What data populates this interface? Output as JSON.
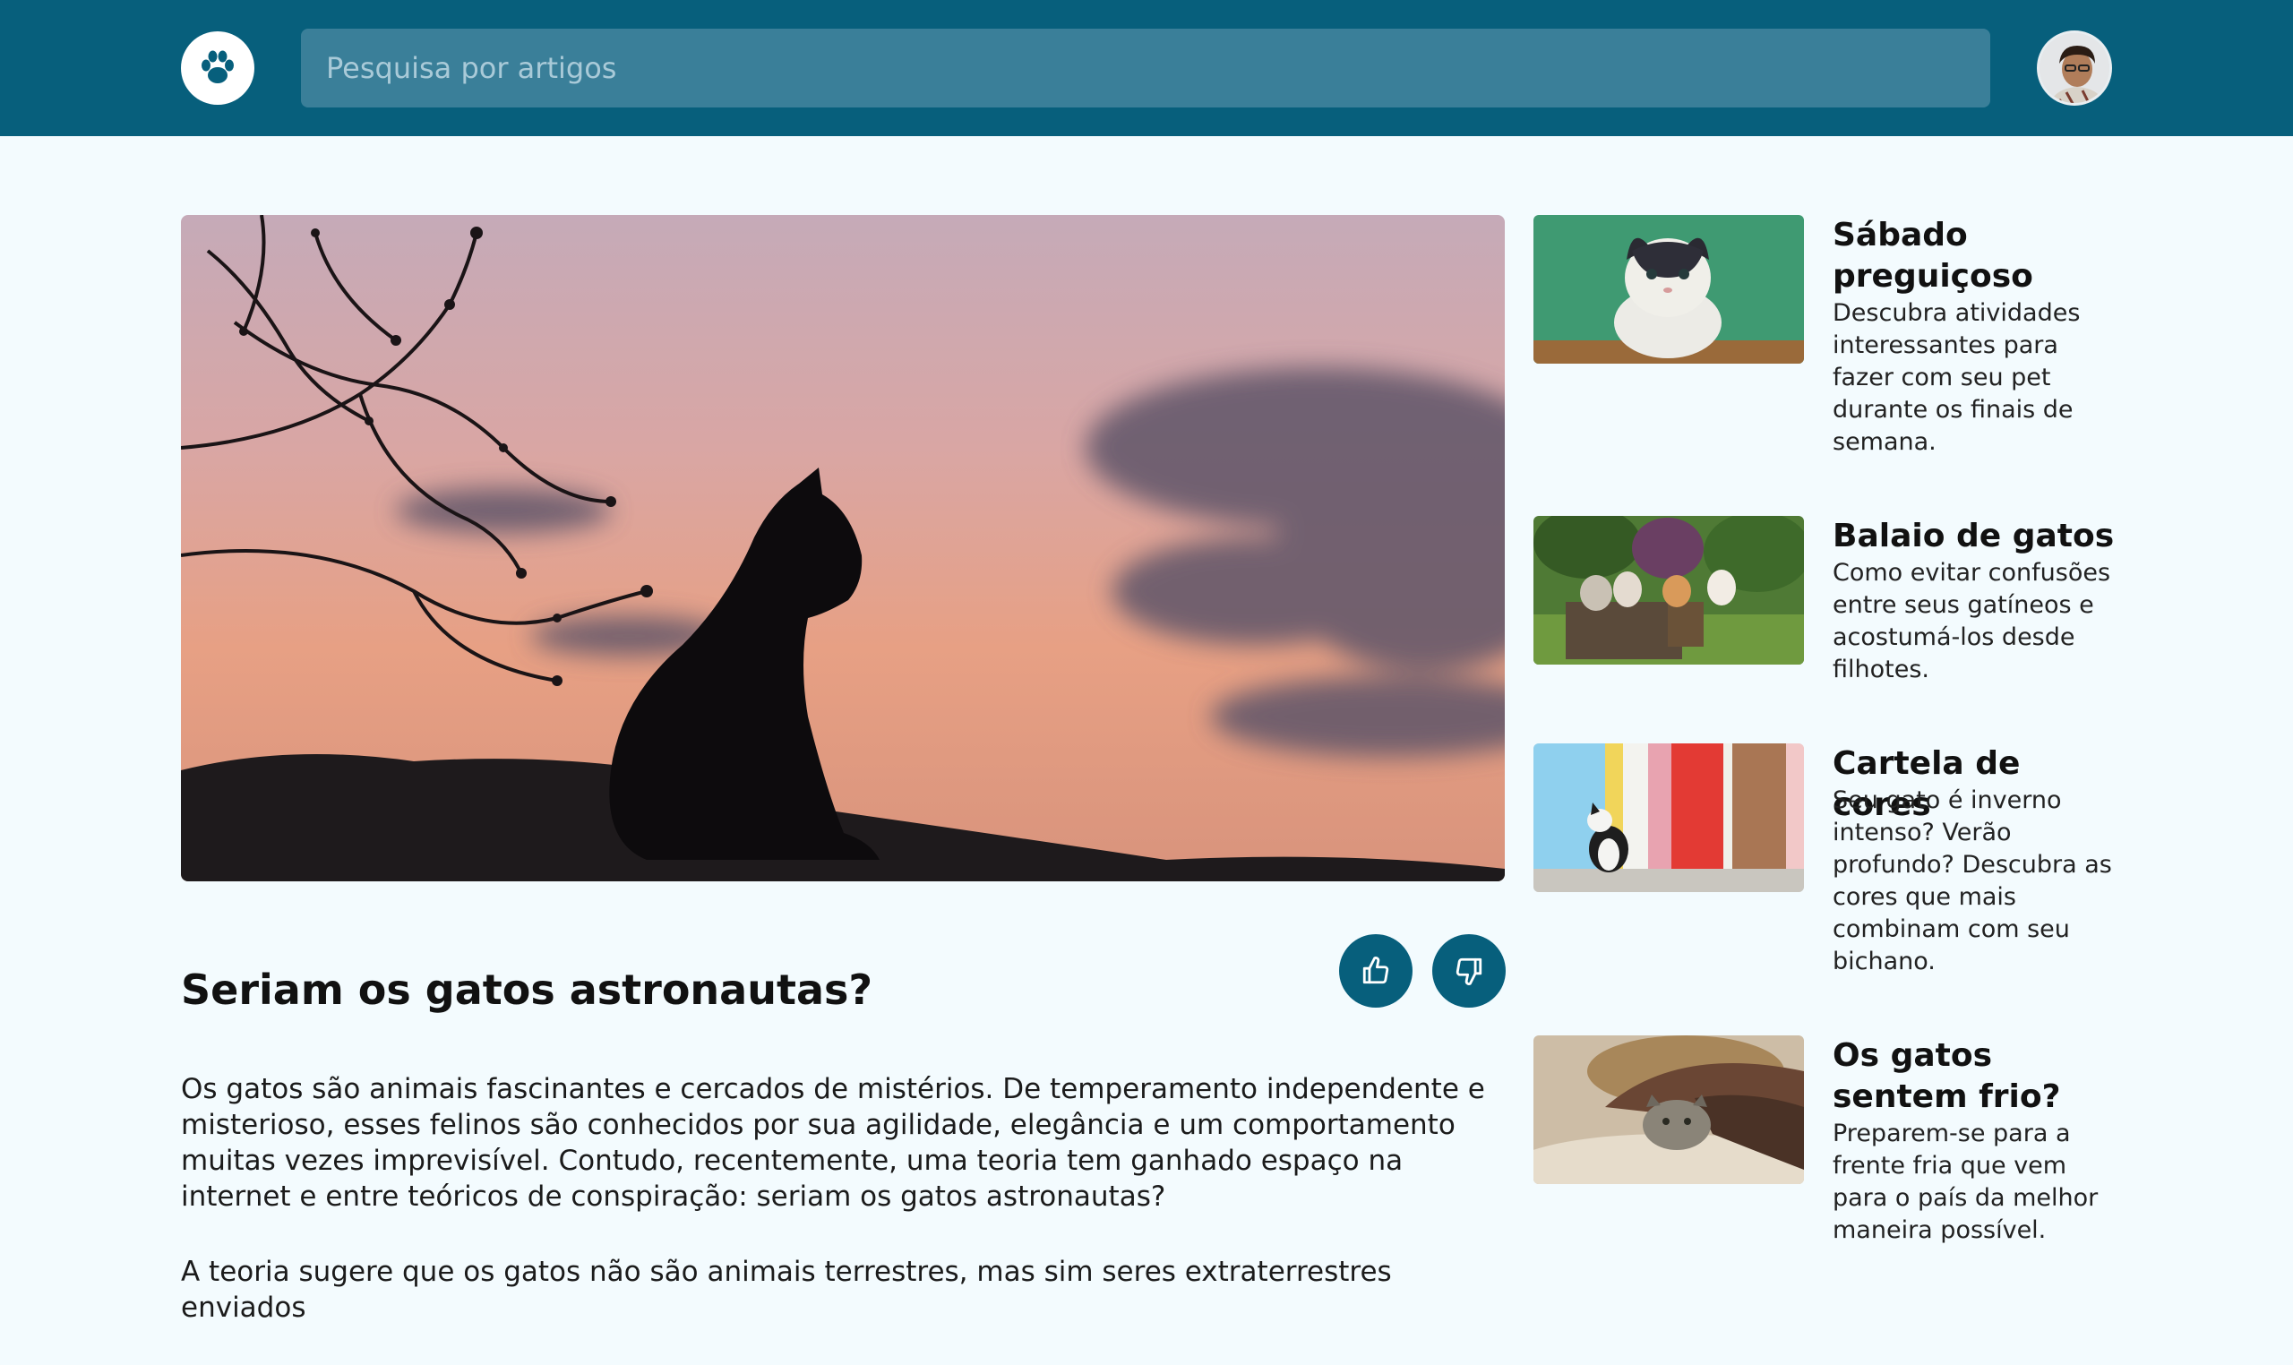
{
  "header": {
    "search_placeholder": "Pesquisa por artigos"
  },
  "article": {
    "title": "Seriam os gatos astronautas?",
    "paragraphs": [
      "Os gatos são animais fascinantes e cercados de mistérios. De temperamento independente e misterioso, esses felinos são conhecidos por sua agilidade, elegância e um comportamento muitas vezes imprevisível. Contudo, recentemente, uma teoria tem ganhado espaço na internet e entre teóricos de conspiração: seriam os gatos astronautas?",
      "A teoria sugere que os gatos não são animais terrestres, mas sim seres extraterrestres enviados"
    ]
  },
  "sidebar": {
    "cards": [
      {
        "title": "Sábado preguiçoso",
        "desc": "Descubra atividades interessantes para fazer com seu pet durante os finais de semana."
      },
      {
        "title": "Balaio de gatos",
        "desc": "Como evitar confusões entre seus gatíneos e acostumá-los desde filhotes."
      },
      {
        "title": "Cartela de cores",
        "desc": "Seu gato é inverno intenso? Verão profundo? Descubra as cores que mais combinam com seu bichano."
      },
      {
        "title": "Os gatos sentem frio?",
        "desc": "Preparem-se para a frente fria que vem para o país da melhor maneira possível."
      }
    ]
  },
  "colors": {
    "brand": "#075f7c",
    "search_bg": "#3a7f99",
    "page_bg": "#f3fbfe"
  },
  "icons": {
    "logo": "paw-icon",
    "like": "thumbs-up-icon",
    "dislike": "thumbs-down-icon"
  }
}
